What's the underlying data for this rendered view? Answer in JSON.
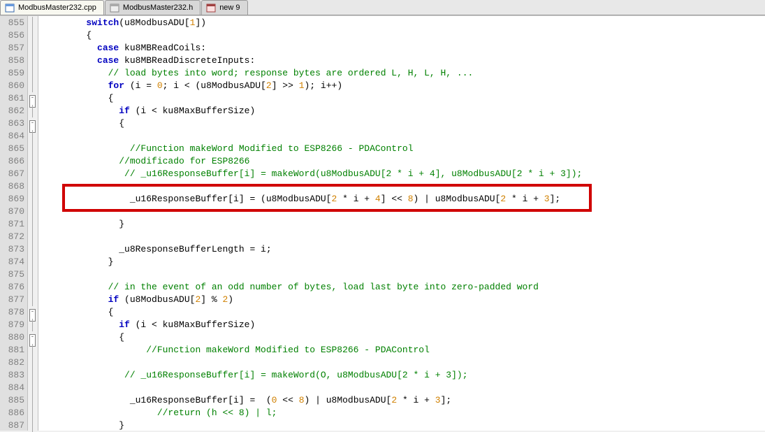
{
  "tabs": [
    {
      "label": "ModbusMaster232.cpp",
      "active": true,
      "icon": "cpp"
    },
    {
      "label": "ModbusMaster232.h",
      "active": false,
      "icon": "h"
    },
    {
      "label": "new 9",
      "active": false,
      "icon": "new"
    }
  ],
  "first_line": 855,
  "last_line": 887,
  "highlight_line": 869,
  "fold_markers": {
    "861": "open",
    "863": "open",
    "878": "open",
    "880": "open"
  },
  "lines": {
    "855": [
      [
        "",
        "        "
      ],
      [
        "kw",
        "switch"
      ],
      [
        "txt",
        "(u8ModbusADU["
      ],
      [
        "num",
        "1"
      ],
      [
        "txt",
        "])"
      ]
    ],
    "856": [
      [
        "",
        "        "
      ],
      [
        "txt",
        "{"
      ]
    ],
    "857": [
      [
        "",
        "          "
      ],
      [
        "kw",
        "case"
      ],
      [
        "txt",
        " ku8MBReadCoils:"
      ]
    ],
    "858": [
      [
        "",
        "          "
      ],
      [
        "kw",
        "case"
      ],
      [
        "txt",
        " ku8MBReadDiscreteInputs:"
      ]
    ],
    "859": [
      [
        "",
        "            "
      ],
      [
        "com",
        "// load bytes into word; response bytes are ordered L, H, L, H, ..."
      ]
    ],
    "860": [
      [
        "",
        "            "
      ],
      [
        "kw",
        "for"
      ],
      [
        "txt",
        " (i = "
      ],
      [
        "num",
        "0"
      ],
      [
        "txt",
        "; i < (u8ModbusADU["
      ],
      [
        "num",
        "2"
      ],
      [
        "txt",
        "] >> "
      ],
      [
        "num",
        "1"
      ],
      [
        "txt",
        "); i++)"
      ]
    ],
    "861": [
      [
        "",
        "            "
      ],
      [
        "txt",
        "{"
      ]
    ],
    "862": [
      [
        "",
        "              "
      ],
      [
        "kw",
        "if"
      ],
      [
        "txt",
        " (i < ku8MaxBufferSize)"
      ]
    ],
    "863": [
      [
        "",
        "              "
      ],
      [
        "txt",
        "{"
      ]
    ],
    "864": [
      [
        "",
        ""
      ]
    ],
    "865": [
      [
        "",
        "                "
      ],
      [
        "com",
        "//Function makeWord Modified to ESP8266 - PDAControl"
      ]
    ],
    "866": [
      [
        "",
        "              "
      ],
      [
        "com",
        "//modificado for ESP8266"
      ]
    ],
    "867": [
      [
        "",
        "               "
      ],
      [
        "com",
        "// _u16ResponseBuffer[i] = makeWord(u8ModbusADU[2 * i + 4], u8ModbusADU[2 * i + 3]);"
      ]
    ],
    "868": [
      [
        "",
        ""
      ]
    ],
    "869": [
      [
        "",
        "                "
      ],
      [
        "txt",
        "_u16ResponseBuffer[i] = (u8ModbusADU["
      ],
      [
        "num",
        "2"
      ],
      [
        "txt",
        " * i + "
      ],
      [
        "num",
        "4"
      ],
      [
        "txt",
        "] << "
      ],
      [
        "num",
        "8"
      ],
      [
        "txt",
        ") | u8ModbusADU["
      ],
      [
        "num",
        "2"
      ],
      [
        "txt",
        " * i + "
      ],
      [
        "num",
        "3"
      ],
      [
        "txt",
        "];"
      ]
    ],
    "870": [
      [
        "",
        ""
      ]
    ],
    "871": [
      [
        "",
        "              "
      ],
      [
        "txt",
        "}"
      ]
    ],
    "872": [
      [
        "",
        ""
      ]
    ],
    "873": [
      [
        "",
        "              "
      ],
      [
        "txt",
        "_u8ResponseBufferLength = i;"
      ]
    ],
    "874": [
      [
        "",
        "            "
      ],
      [
        "txt",
        "}"
      ]
    ],
    "875": [
      [
        "",
        ""
      ]
    ],
    "876": [
      [
        "",
        "            "
      ],
      [
        "com",
        "// in the event of an odd number of bytes, load last byte into zero-padded word"
      ]
    ],
    "877": [
      [
        "",
        "            "
      ],
      [
        "kw",
        "if"
      ],
      [
        "txt",
        " (u8ModbusADU["
      ],
      [
        "num",
        "2"
      ],
      [
        "txt",
        "] % "
      ],
      [
        "num",
        "2"
      ],
      [
        "txt",
        ")"
      ]
    ],
    "878": [
      [
        "",
        "            "
      ],
      [
        "txt",
        "{"
      ]
    ],
    "879": [
      [
        "",
        "              "
      ],
      [
        "kw",
        "if"
      ],
      [
        "txt",
        " (i < ku8MaxBufferSize)"
      ]
    ],
    "880": [
      [
        "",
        "              "
      ],
      [
        "txt",
        "{"
      ]
    ],
    "881": [
      [
        "",
        "                   "
      ],
      [
        "com",
        "//Function makeWord Modified to ESP8266 - PDAControl"
      ]
    ],
    "882": [
      [
        "",
        ""
      ]
    ],
    "883": [
      [
        "",
        "               "
      ],
      [
        "com",
        "// _u16ResponseBuffer[i] = makeWord(O, u8ModbusADU[2 * i + 3]);"
      ]
    ],
    "884": [
      [
        "",
        ""
      ]
    ],
    "885": [
      [
        "",
        "                "
      ],
      [
        "txt",
        "_u16ResponseBuffer[i] =  ("
      ],
      [
        "num",
        "0"
      ],
      [
        "txt",
        " << "
      ],
      [
        "num",
        "8"
      ],
      [
        "txt",
        ") | u8ModbusADU["
      ],
      [
        "num",
        "2"
      ],
      [
        "txt",
        " * i + "
      ],
      [
        "num",
        "3"
      ],
      [
        "txt",
        "];"
      ]
    ],
    "886": [
      [
        "",
        "                     "
      ],
      [
        "com",
        "//return (h << 8) | l;"
      ]
    ],
    "887": [
      [
        "",
        "              "
      ],
      [
        "txt",
        "}"
      ]
    ]
  }
}
